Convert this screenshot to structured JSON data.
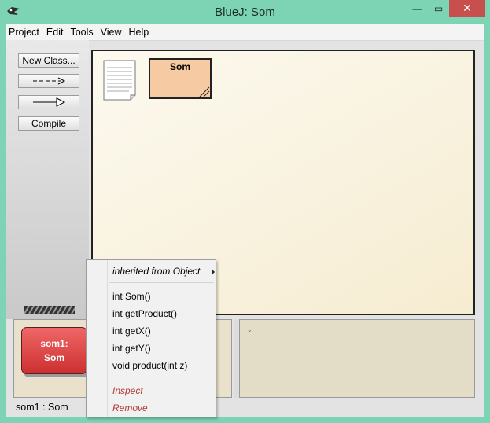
{
  "window": {
    "title": "BlueJ:  Som",
    "buttons": {
      "minimize": "—",
      "maximize": "▭",
      "close": "✕"
    }
  },
  "menubar": {
    "items": [
      "Project",
      "Edit",
      "Tools",
      "View",
      "Help"
    ]
  },
  "toolbar": {
    "new_class": "New Class...",
    "compile": "Compile"
  },
  "diagram": {
    "class_name": "Som"
  },
  "object_bench": {
    "object_name": "som1:",
    "object_class": "Som"
  },
  "status_bar": {
    "text": "som1 : Som"
  },
  "popup_menu": {
    "inherited": "inherited from Object",
    "methods": [
      "int Som()",
      "int getProduct()",
      "int getX()",
      "int getY()",
      "void product(int z)"
    ],
    "inspect": "Inspect",
    "remove": "Remove"
  },
  "colors": {
    "titlebar": "#7dd4b4",
    "class_fill": "#f6cba3",
    "object_fill": "#e04848",
    "close_button": "#c7504f"
  }
}
